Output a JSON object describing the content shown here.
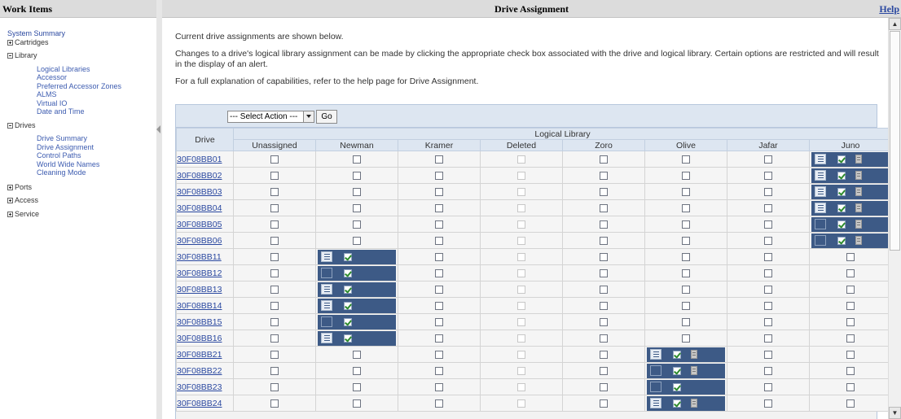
{
  "left_panel": {
    "title": "Work Items",
    "tree": {
      "system_summary": "System Summary",
      "cartridges": "Cartridges",
      "library": "Library",
      "library_children": [
        "Logical Libraries",
        "Accessor",
        "Preferred Accessor Zones",
        "ALMS",
        "Virtual IO",
        "Date and Time"
      ],
      "drives": "Drives",
      "drives_children": [
        "Drive Summary",
        "Drive Assignment",
        "Control Paths",
        "World Wide Names",
        "Cleaning Mode"
      ],
      "ports": "Ports",
      "access": "Access",
      "service": "Service"
    }
  },
  "main": {
    "title": "Drive Assignment",
    "help_label": "Help",
    "intro_1": "Current drive assignments are shown below.",
    "intro_2": "Changes to a drive's logical library assignment can be made by clicking the appropriate check box associated with the drive and logical library. Certain options are restricted and will result in the display of an alert.",
    "intro_3": "For a full explanation of capabilities, refer to the help page for Drive Assignment.",
    "select_action": "--- Select Action ---",
    "go_label": "Go"
  },
  "table": {
    "drive_header": "Drive",
    "group_header": "Logical Library",
    "columns": [
      "Unassigned",
      "Newman",
      "Kramer",
      "Deleted",
      "Zoro",
      "Olive",
      "Jafar",
      "Juno"
    ],
    "rows": [
      {
        "drive": "30F08BB01",
        "assigned": "Juno",
        "icons": "page,check,cal"
      },
      {
        "drive": "30F08BB02",
        "assigned": "Juno",
        "icons": "page,check,cal"
      },
      {
        "drive": "30F08BB03",
        "assigned": "Juno",
        "icons": "page,check,cal"
      },
      {
        "drive": "30F08BB04",
        "assigned": "Juno",
        "icons": "page,check,cal"
      },
      {
        "drive": "30F08BB05",
        "assigned": "Juno",
        "icons": "blank,check,cal"
      },
      {
        "drive": "30F08BB06",
        "assigned": "Juno",
        "icons": "blank,check,cal"
      },
      {
        "drive": "30F08BB11",
        "assigned": "Newman",
        "icons": "page,check"
      },
      {
        "drive": "30F08BB12",
        "assigned": "Newman",
        "icons": "blank,check"
      },
      {
        "drive": "30F08BB13",
        "assigned": "Newman",
        "icons": "page,check"
      },
      {
        "drive": "30F08BB14",
        "assigned": "Newman",
        "icons": "page,check"
      },
      {
        "drive": "30F08BB15",
        "assigned": "Newman",
        "icons": "blank,check"
      },
      {
        "drive": "30F08BB16",
        "assigned": "Newman",
        "icons": "page,check"
      },
      {
        "drive": "30F08BB21",
        "assigned": "Olive",
        "icons": "page,check,cal"
      },
      {
        "drive": "30F08BB22",
        "assigned": "Olive",
        "icons": "blank,check,cal"
      },
      {
        "drive": "30F08BB23",
        "assigned": "Olive",
        "icons": "blank,check"
      },
      {
        "drive": "30F08BB24",
        "assigned": "Olive",
        "icons": "page,check,cal"
      }
    ]
  },
  "colors": {
    "assigned_cell": "#3d5a86",
    "header_bg": "#dcdcdc",
    "link": "#2a48a0"
  }
}
